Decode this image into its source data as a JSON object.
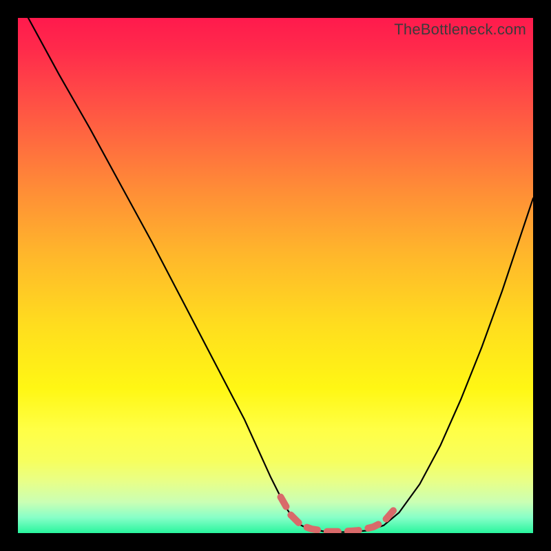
{
  "watermark": "TheBottleneck.com",
  "chart_data": {
    "type": "line",
    "title": "",
    "xlabel": "",
    "ylabel": "",
    "xlim": [
      0,
      100
    ],
    "ylim": [
      0,
      100
    ],
    "series": [
      {
        "name": "curve",
        "color": "#000000",
        "x": [
          2,
          8,
          14,
          20,
          26,
          32,
          38,
          44,
          49,
          52,
          54,
          56,
          60,
          64,
          68,
          71,
          74,
          78,
          82,
          86,
          90,
          94,
          98,
          100
        ],
        "y": [
          100,
          89,
          78.5,
          67.5,
          56.5,
          45,
          33.5,
          22,
          11,
          5,
          2,
          1,
          0.2,
          0.2,
          0.5,
          1.5,
          4,
          9.5,
          17,
          26,
          36,
          47,
          59,
          65
        ]
      },
      {
        "name": "highlight",
        "color": "#d96a6a",
        "style": "dashed",
        "x": [
          51,
          53,
          55,
          57,
          60,
          63,
          66,
          69,
          71,
          73
        ],
        "y": [
          7,
          3.5,
          1.5,
          0.8,
          0.3,
          0.3,
          0.5,
          1.2,
          2.2,
          4.5
        ]
      }
    ],
    "gradient_stops": [
      {
        "pos": 0,
        "color": "#ff1a4d"
      },
      {
        "pos": 14,
        "color": "#ff4747"
      },
      {
        "pos": 34,
        "color": "#ff8f36"
      },
      {
        "pos": 60,
        "color": "#ffde1e"
      },
      {
        "pos": 80,
        "color": "#ffff46"
      },
      {
        "pos": 94,
        "color": "#caffb4"
      },
      {
        "pos": 100,
        "color": "#28f59d"
      }
    ]
  }
}
